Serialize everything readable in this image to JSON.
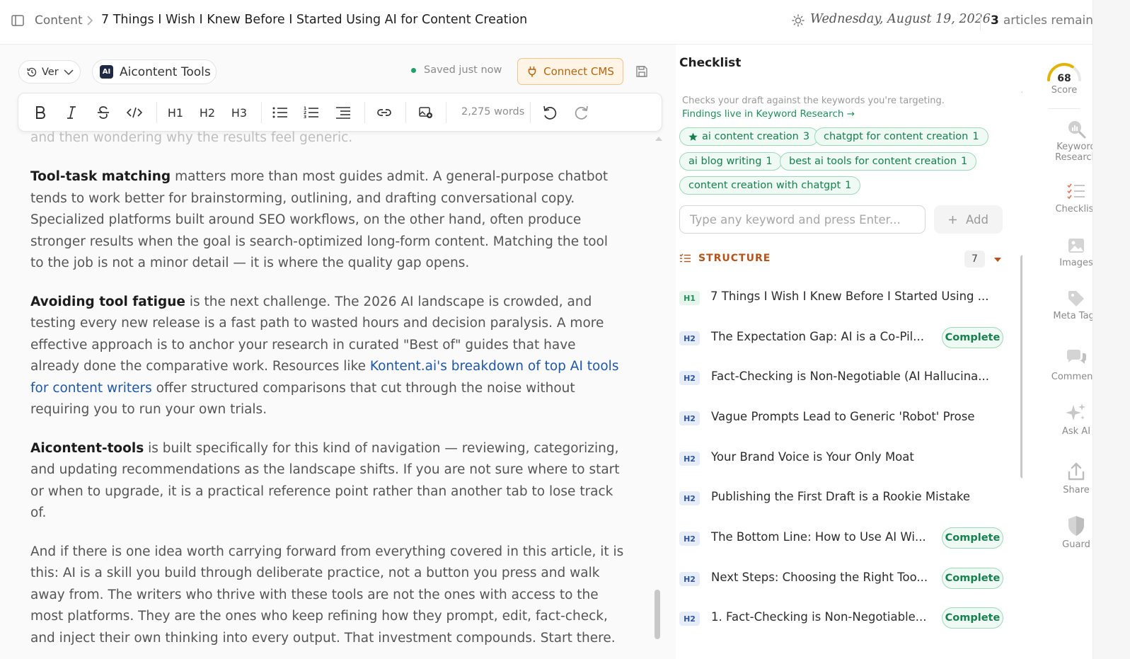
{
  "topbar": {
    "breadcrumb_root": "Content",
    "article_title": "7 Things I Wish I Knew Before I Started Using AI for Content Creation",
    "date": "Wednesday, August 19, 2026",
    "articles_remaining_count": "3",
    "articles_remaining_label": "articles remaining"
  },
  "editor": {
    "version_label": "Ver",
    "tools_label": "Aicontent Tools",
    "tools_logo": "AI",
    "saved_status": "Saved just now",
    "connect_cms_label": "Connect CMS",
    "toolbar": {
      "h1": "H1",
      "h2": "H2",
      "h3": "H3",
      "word_count": "2,275 words"
    },
    "faded_line": "and then wondering why the results feel generic.",
    "paragraphs": [
      {
        "bold": "Tool-task matching",
        "text": " matters more than most guides admit. A general-purpose chatbot tends to work better for brainstorming, outlining, and drafting conversational copy. Specialized platforms built around SEO workflows, on the other hand, often produce stronger results when the goal is search-optimized long-form content. Matching the tool to the job is not a minor detail — it is where the quality gap opens."
      },
      {
        "bold": "Avoiding tool fatigue",
        "text_before_link": " is the next challenge. The 2026 AI landscape is crowded, and testing every new release is a fast path to wasted hours and decision paralysis. A more effective approach is to anchor your research in curated \"Best of\" guides that have already done the comparative work. Resources like ",
        "link": "Kontent.ai's breakdown of top AI tools for content writers",
        "text_after_link": " offer structured comparisons that cut through the noise without requiring you to run your own trials."
      },
      {
        "bold": "Aicontent-tools",
        "text": " is built specifically for this kind of navigation — reviewing, categorizing, and updating recommendations as the landscape shifts. If you are not sure where to start or when to upgrade, it is a practical reference point rather than another tab to lose track of."
      },
      {
        "text": "And if there is one idea worth carrying forward from everything covered in this article, it is this: AI is a skill you build through deliberate practice, not a button you press and walk away from. The writers who thrive with these tools are not the ones with access to the most platforms. They are the ones who keep refining how they prompt, edit, fact-check, and inject their own thinking into every output. That investment compounds. Start there."
      }
    ]
  },
  "checklist": {
    "title": "Checklist",
    "description": "Checks your draft against the keywords you're targeting.",
    "link": "Findings live in Keyword Research →",
    "keywords": [
      {
        "label": "ai content creation",
        "count": "3",
        "primary": true
      },
      {
        "label": "chatgpt for content creation",
        "count": "1",
        "primary": false
      },
      {
        "label": "ai blog writing",
        "count": "1",
        "primary": false
      },
      {
        "label": "best ai tools for content creation",
        "count": "1",
        "primary": false
      },
      {
        "label": "content creation with chatgpt",
        "count": "1",
        "primary": false
      }
    ],
    "keyword_input_placeholder": "Type any keyword and press Enter...",
    "add_label": "Add",
    "structure_label": "STRUCTURE",
    "structure_count": "7",
    "complete_label": "Complete",
    "structure_items": [
      {
        "level": "H1",
        "text": "7 Things I Wish I Knew Before I Started Using ...",
        "complete": false
      },
      {
        "level": "H2",
        "text": "The Expectation Gap: AI is a Co-Pil...",
        "complete": true
      },
      {
        "level": "H2",
        "text": "Fact-Checking is Non-Negotiable (AI Hallucina...",
        "complete": false
      },
      {
        "level": "H2",
        "text": "Vague Prompts Lead to Generic 'Robot' Prose",
        "complete": false
      },
      {
        "level": "H2",
        "text": "Your Brand Voice is Your Only Moat",
        "complete": false
      },
      {
        "level": "H2",
        "text": "Publishing the First Draft is a Rookie Mistake",
        "complete": false
      },
      {
        "level": "H2",
        "text": "The Bottom Line: How to Use AI Wi...",
        "complete": true
      },
      {
        "level": "H2",
        "text": "Next Steps: Choosing the Right Too...",
        "complete": true
      },
      {
        "level": "H2",
        "text": "1. Fact-Checking is Non-Negotiable...",
        "complete": true
      }
    ]
  },
  "rail": {
    "score_value": "68",
    "score_fraction": 0.68,
    "score_label": "Score",
    "items": [
      {
        "label_line1": "Keyword",
        "label_line2": "Research",
        "icon": "keyword-research-icon"
      },
      {
        "label_line1": "Checklist",
        "label_line2": "",
        "icon": "checklist-icon"
      },
      {
        "label_line1": "Images",
        "label_line2": "",
        "icon": "image-icon"
      },
      {
        "label_line1": "Meta Tags",
        "label_line2": "",
        "icon": "tag-icon"
      },
      {
        "label_line1": "Comments",
        "label_line2": "",
        "icon": "comments-icon"
      },
      {
        "label_line1": "Ask AI",
        "label_line2": "",
        "icon": "sparkle-icon"
      },
      {
        "label_line1": "Share",
        "label_line2": "",
        "icon": "share-icon"
      },
      {
        "label_line1": "Guard",
        "label_line2": "",
        "icon": "shield-icon"
      }
    ]
  },
  "colors": {
    "accent_green": "#17804f",
    "structure_orange": "#b4531a",
    "cms_orange": "#b4650c",
    "link_blue": "#1f57a8",
    "score_gauge": "#e0b400"
  }
}
